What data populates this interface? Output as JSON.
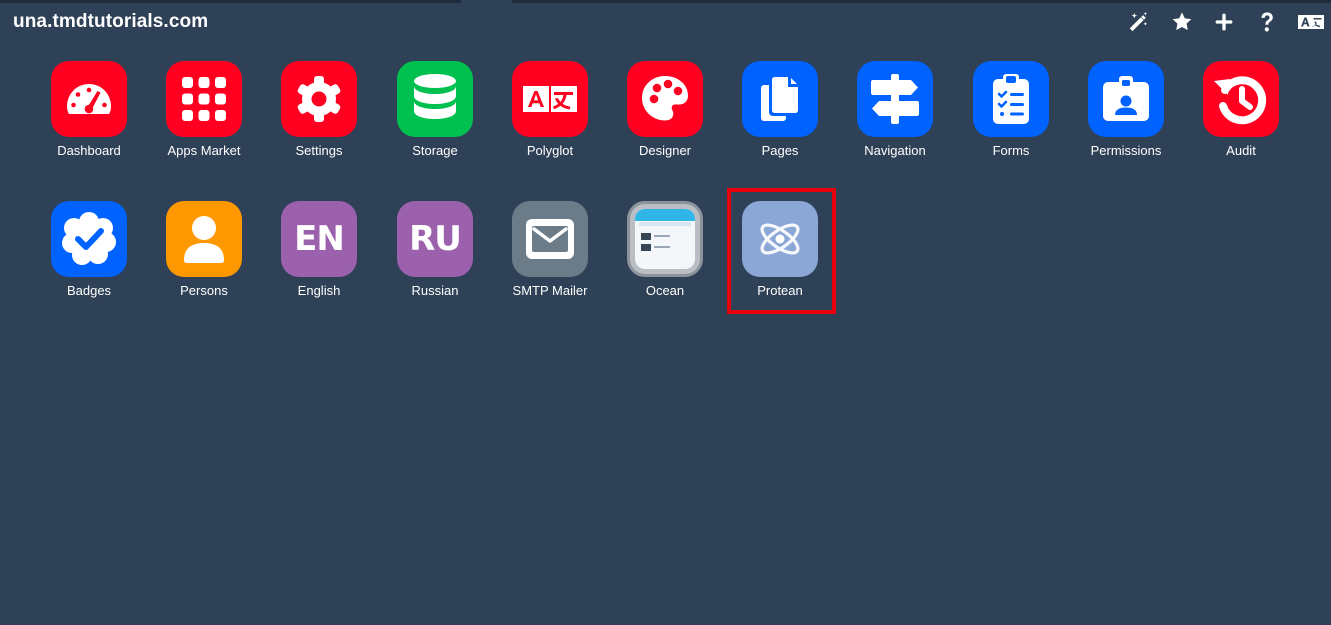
{
  "site": {
    "title": "una.tmdtutorials.com"
  },
  "toolbar": {
    "items": [
      {
        "icon": "magic-wand-icon"
      },
      {
        "icon": "star-icon"
      },
      {
        "icon": "plus-icon"
      },
      {
        "icon": "question-icon"
      },
      {
        "icon": "language-icon"
      }
    ]
  },
  "apps": [
    {
      "label": "Dashboard",
      "color": "#ff0020",
      "icon": "dashboard-gauge-icon"
    },
    {
      "label": "Apps Market",
      "color": "#ff0020",
      "icon": "grid-icon"
    },
    {
      "label": "Settings",
      "color": "#ff0020",
      "icon": "gear-icon"
    },
    {
      "label": "Storage",
      "color": "#00c050",
      "icon": "database-icon"
    },
    {
      "label": "Polyglot",
      "color": "#ff0020",
      "icon": "language-icon"
    },
    {
      "label": "Designer",
      "color": "#ff0020",
      "icon": "palette-icon"
    },
    {
      "label": "Pages",
      "color": "#0062ff",
      "icon": "pages-icon"
    },
    {
      "label": "Navigation",
      "color": "#0062ff",
      "icon": "signpost-icon"
    },
    {
      "label": "Forms",
      "color": "#0062ff",
      "icon": "clipboard-list-icon"
    },
    {
      "label": "Permissions",
      "color": "#0062ff",
      "icon": "id-badge-icon"
    },
    {
      "label": "Audit",
      "color": "#ff0020",
      "icon": "history-icon"
    },
    {
      "label": "Badges",
      "color": "#0062ff",
      "icon": "verified-badge-icon"
    },
    {
      "label": "Persons",
      "color": "#ff9800",
      "icon": "person-icon"
    },
    {
      "label": "English",
      "color": "#9c61ad",
      "icon": "text-tile-icon",
      "tile_text": "EN"
    },
    {
      "label": "Russian",
      "color": "#9c61ad",
      "icon": "text-tile-icon",
      "tile_text": "RU"
    },
    {
      "label": "SMTP Mailer",
      "color": "#6b7c88",
      "icon": "envelope-icon"
    },
    {
      "label": "Ocean",
      "color": "#b9bec5",
      "icon": "ocean-template-thumbnail-icon"
    },
    {
      "label": "Protean",
      "color": "#8aa7d6",
      "icon": "atom-icon",
      "highlighted": true
    }
  ],
  "colors": {
    "background": "#2e4156",
    "highlight": "#e8000f"
  }
}
